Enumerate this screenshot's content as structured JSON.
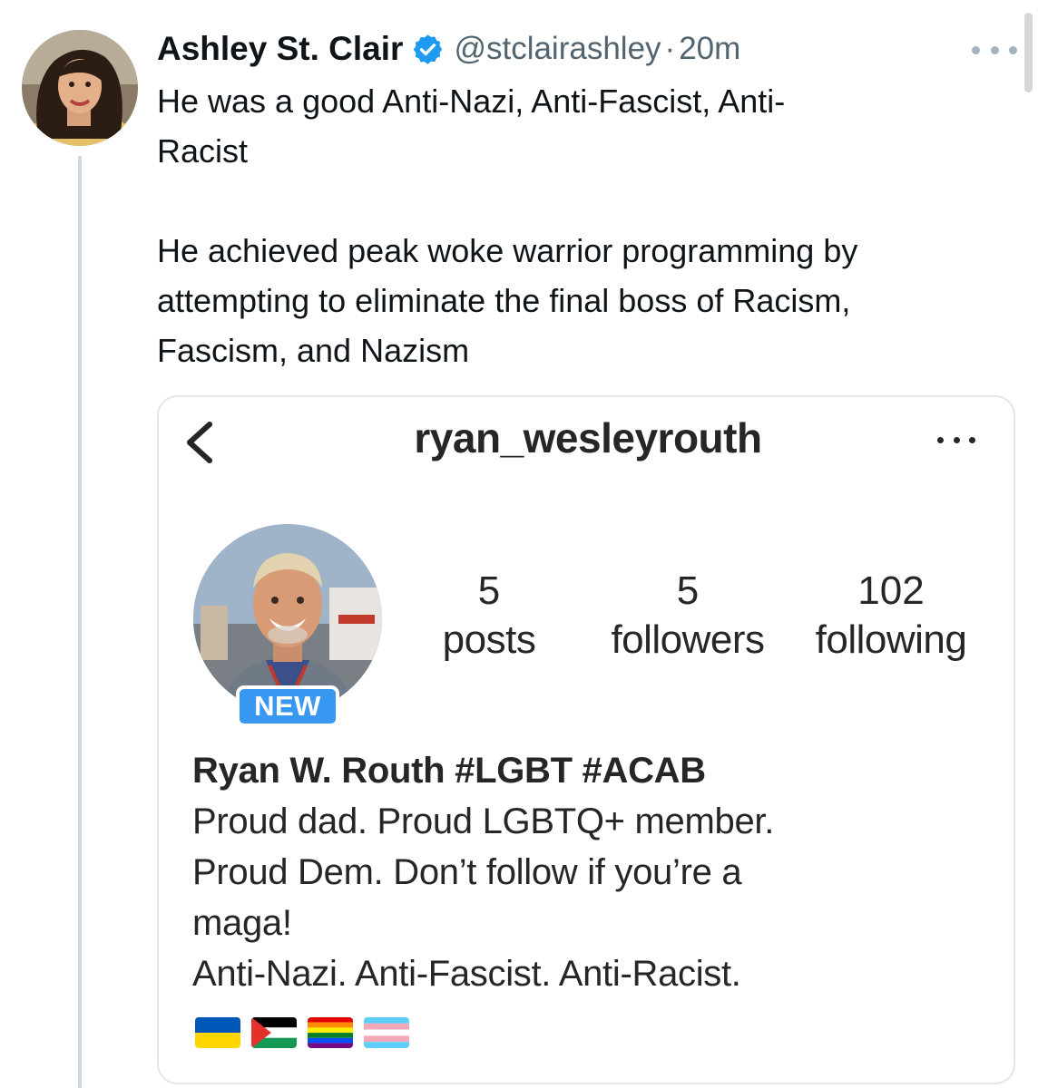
{
  "tweet": {
    "display_name": "Ashley St. Clair",
    "handle": "@stclairashley",
    "separator": "·",
    "time": "20m",
    "text_lines": [
      "He was a good Anti-Nazi, Anti-Fascist, Anti-",
      "Racist",
      "",
      "He achieved peak woke warrior programming by",
      "attempting to eliminate the final boss of Racism,",
      "Fascism, and Nazism"
    ]
  },
  "embedded_profile": {
    "username": "ryan_wesleyrouth",
    "badge": "NEW",
    "stats": [
      {
        "value": "5",
        "label": "posts"
      },
      {
        "value": "5",
        "label": "followers"
      },
      {
        "value": "102",
        "label": "following"
      }
    ],
    "bio": {
      "name": "Ryan W. Routh #LGBT #ACAB",
      "lines": [
        "Proud dad. Proud LGBTQ+ member.",
        "Proud Dem. Don’t follow if you’re a",
        "maga!",
        "Anti-Nazi. Anti-Fascist. Anti-Racist."
      ]
    },
    "flag_icons": [
      "ukraine-flag",
      "palestine-flag",
      "rainbow-pride-flag",
      "transgender-flag"
    ]
  },
  "colors": {
    "verified_badge": "#1d9bf0",
    "new_badge": "#3897f0",
    "secondary_text": "#536471"
  }
}
